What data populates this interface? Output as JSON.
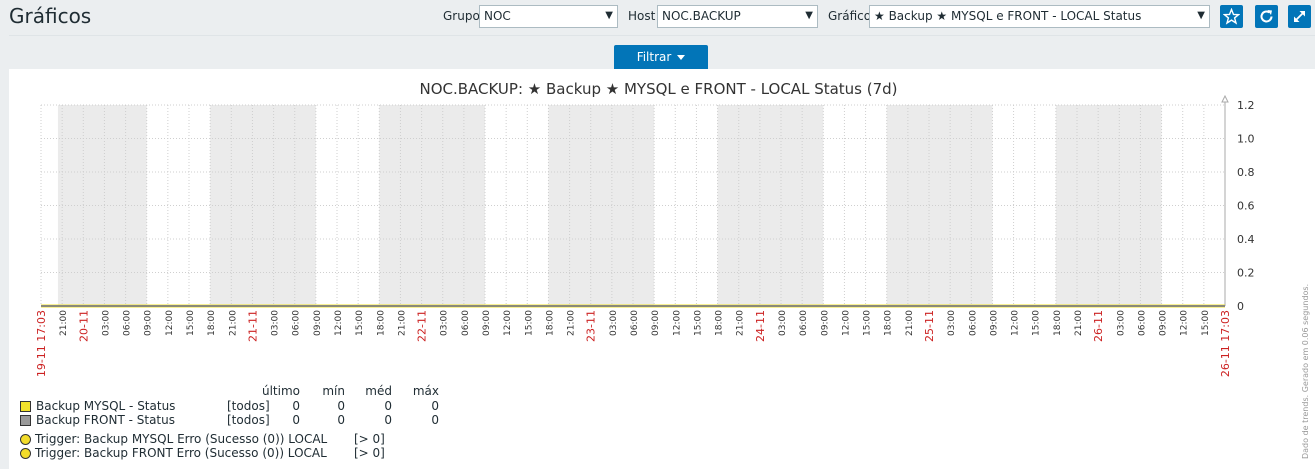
{
  "page": {
    "title": "Gráficos"
  },
  "filters": {
    "group_label": "Grupo",
    "group_value": "NOC",
    "host_label": "Host",
    "host_value": "NOC.BACKUP",
    "graph_label": "Gráfico",
    "graph_value": "★ Backup ★ MYSQL e FRONT - LOCAL Status",
    "filter_button": "Filtrar"
  },
  "icons": {
    "favorite": "star-icon",
    "refresh": "refresh-icon",
    "fullscreen": "fullscreen-icon"
  },
  "colors": {
    "accent": "#0275b8",
    "date_label": "#cc2222",
    "series_mysql": "#f2e12b",
    "series_front": "#9a9a9a",
    "trigger": "#f2dc2b"
  },
  "chart_data": {
    "type": "line",
    "title": "NOC.BACKUP: ★ Backup ★ MYSQL e FRONT - LOCAL Status (7d)",
    "x_ticks": [
      "19-11 17:03",
      "21:00",
      "20-11",
      "03:00",
      "06:00",
      "09:00",
      "12:00",
      "15:00",
      "18:00",
      "21:00",
      "21-11",
      "03:00",
      "06:00",
      "09:00",
      "12:00",
      "15:00",
      "18:00",
      "21:00",
      "22-11",
      "03:00",
      "06:00",
      "09:00",
      "12:00",
      "15:00",
      "18:00",
      "21:00",
      "23-11",
      "03:00",
      "06:00",
      "09:00",
      "12:00",
      "15:00",
      "18:00",
      "21:00",
      "24-11",
      "03:00",
      "06:00",
      "09:00",
      "12:00",
      "15:00",
      "18:00",
      "21:00",
      "25-11",
      "03:00",
      "06:00",
      "09:00",
      "12:00",
      "15:00",
      "18:00",
      "21:00",
      "26-11",
      "03:00",
      "06:00",
      "09:00",
      "12:00",
      "15:00",
      "26-11 17:03"
    ],
    "x_tick_kind": [
      "date",
      "time",
      "date",
      "time",
      "time",
      "time",
      "time",
      "time",
      "time",
      "time",
      "date",
      "time",
      "time",
      "time",
      "time",
      "time",
      "time",
      "time",
      "date",
      "time",
      "time",
      "time",
      "time",
      "time",
      "time",
      "time",
      "date",
      "time",
      "time",
      "time",
      "time",
      "time",
      "time",
      "time",
      "date",
      "time",
      "time",
      "time",
      "time",
      "time",
      "time",
      "time",
      "date",
      "time",
      "time",
      "time",
      "time",
      "time",
      "time",
      "time",
      "date",
      "time",
      "time",
      "time",
      "time",
      "time",
      "date"
    ],
    "y_ticks": [
      "1.2",
      "1.0",
      "0.8",
      "0.6",
      "0.4",
      "0.2",
      "0"
    ],
    "ylim": [
      0,
      1.2
    ],
    "series": [
      {
        "name": "Backup MYSQL - Status",
        "values": [
          0,
          0
        ]
      },
      {
        "name": "Backup FRONT - Status",
        "values": [
          0,
          0
        ]
      }
    ]
  },
  "legend": {
    "headers": [
      "último",
      "mín",
      "méd",
      "máx"
    ],
    "items": [
      {
        "name": "Backup MYSQL - Status",
        "func": "[todos]",
        "last": "0",
        "min": "0",
        "avg": "0",
        "max": "0"
      },
      {
        "name": "Backup FRONT - Status",
        "func": "[todos]",
        "last": "0",
        "min": "0",
        "avg": "0",
        "max": "0"
      }
    ],
    "triggers": [
      {
        "name": "Trigger: Backup MYSQL Erro (Sucesso (0)) LOCAL",
        "value": "[> 0]"
      },
      {
        "name": "Trigger: Backup FRONT Erro (Sucesso (0)) LOCAL",
        "value": "[> 0]"
      }
    ]
  },
  "footnote": "Dado de trends. Gerado em 0.06 segundos."
}
